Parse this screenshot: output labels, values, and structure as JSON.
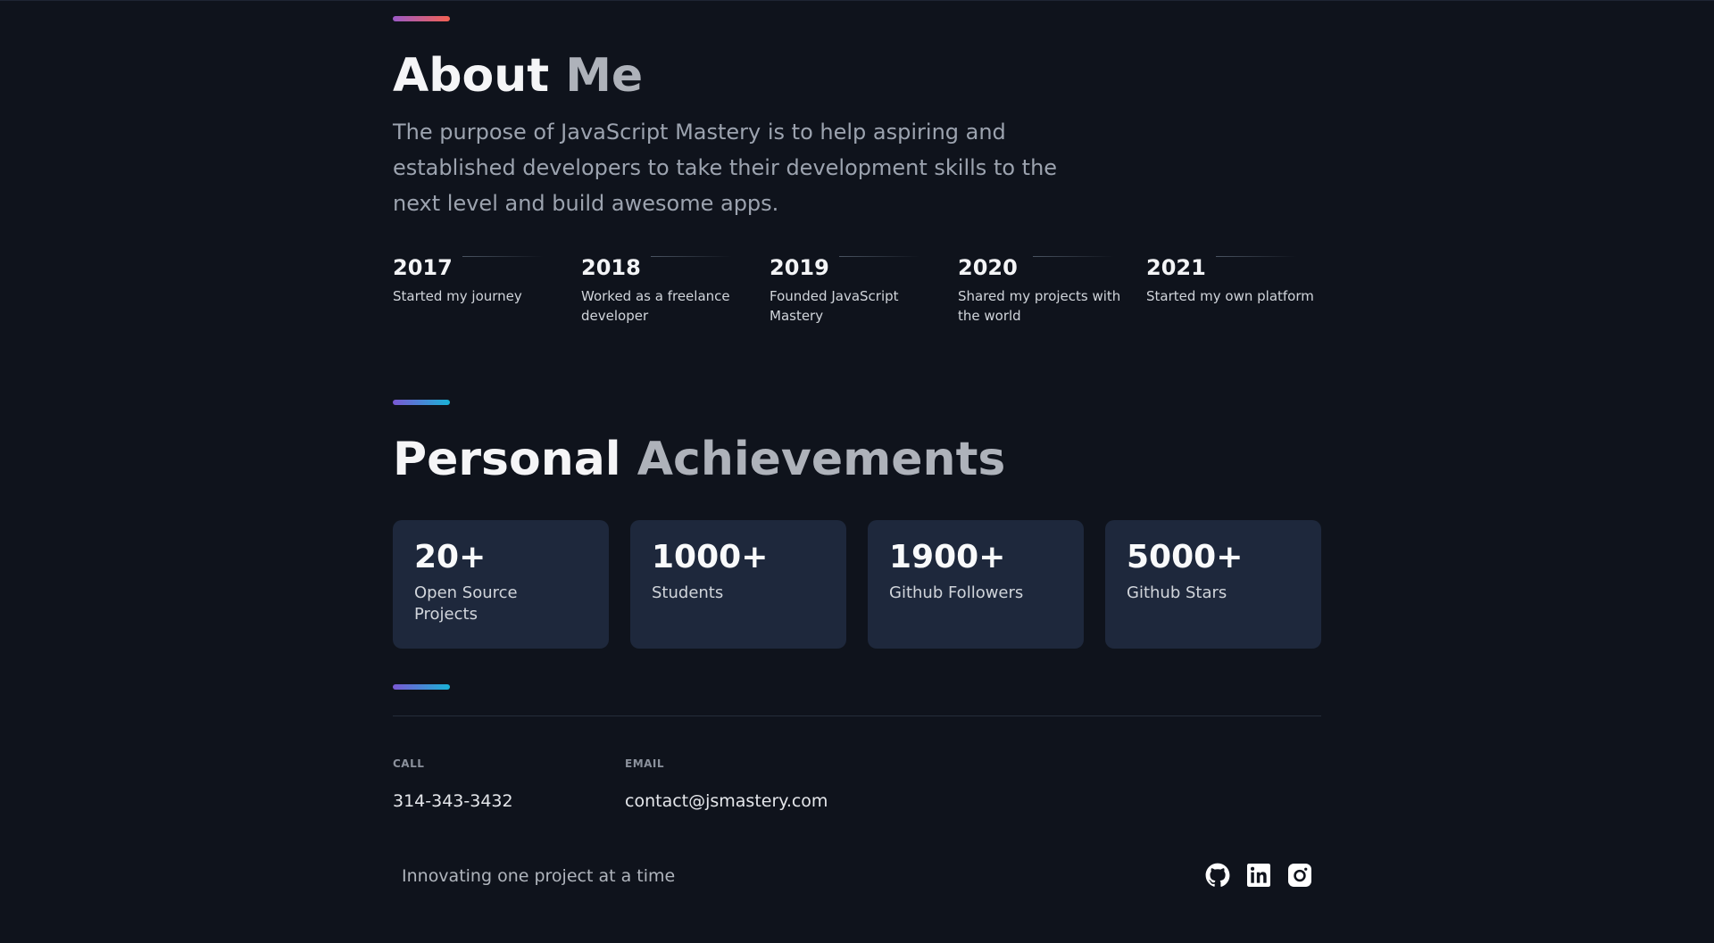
{
  "about": {
    "title_strong": "About",
    "title_muted": "Me",
    "description": "The purpose of JavaScript Mastery is to help aspiring and established developers to take their development skills to the next level and build awesome apps.",
    "timeline": [
      {
        "year": "2017",
        "text": "Started my journey"
      },
      {
        "year": "2018",
        "text": "Worked as a freelance developer"
      },
      {
        "year": "2019",
        "text": "Founded JavaScript Mastery"
      },
      {
        "year": "2020",
        "text": "Shared my projects with the world"
      },
      {
        "year": "2021",
        "text": "Started my own platform"
      }
    ]
  },
  "achievements": {
    "title_strong": "Personal",
    "title_muted": "Achievements",
    "stats": [
      {
        "value": "20+",
        "label": "Open Source Projects"
      },
      {
        "value": "1000+",
        "label": "Students"
      },
      {
        "value": "1900+",
        "label": "Github Followers"
      },
      {
        "value": "5000+",
        "label": "Github Stars"
      }
    ]
  },
  "contact": {
    "call_label": "CALL",
    "call_value": "314-343-3432",
    "email_label": "EMAIL",
    "email_value": "contact@jsmastery.com"
  },
  "footer": {
    "tagline": "Innovating one project at a time",
    "social_icons": [
      "github-icon",
      "linkedin-icon",
      "instagram-icon"
    ]
  },
  "colors": {
    "background": "#0f131c",
    "card": "#1e283c",
    "accent_warm": [
      "#9b5ac7",
      "#f46152"
    ],
    "accent_cool": [
      "#7a58d4",
      "#19b2d6"
    ]
  }
}
